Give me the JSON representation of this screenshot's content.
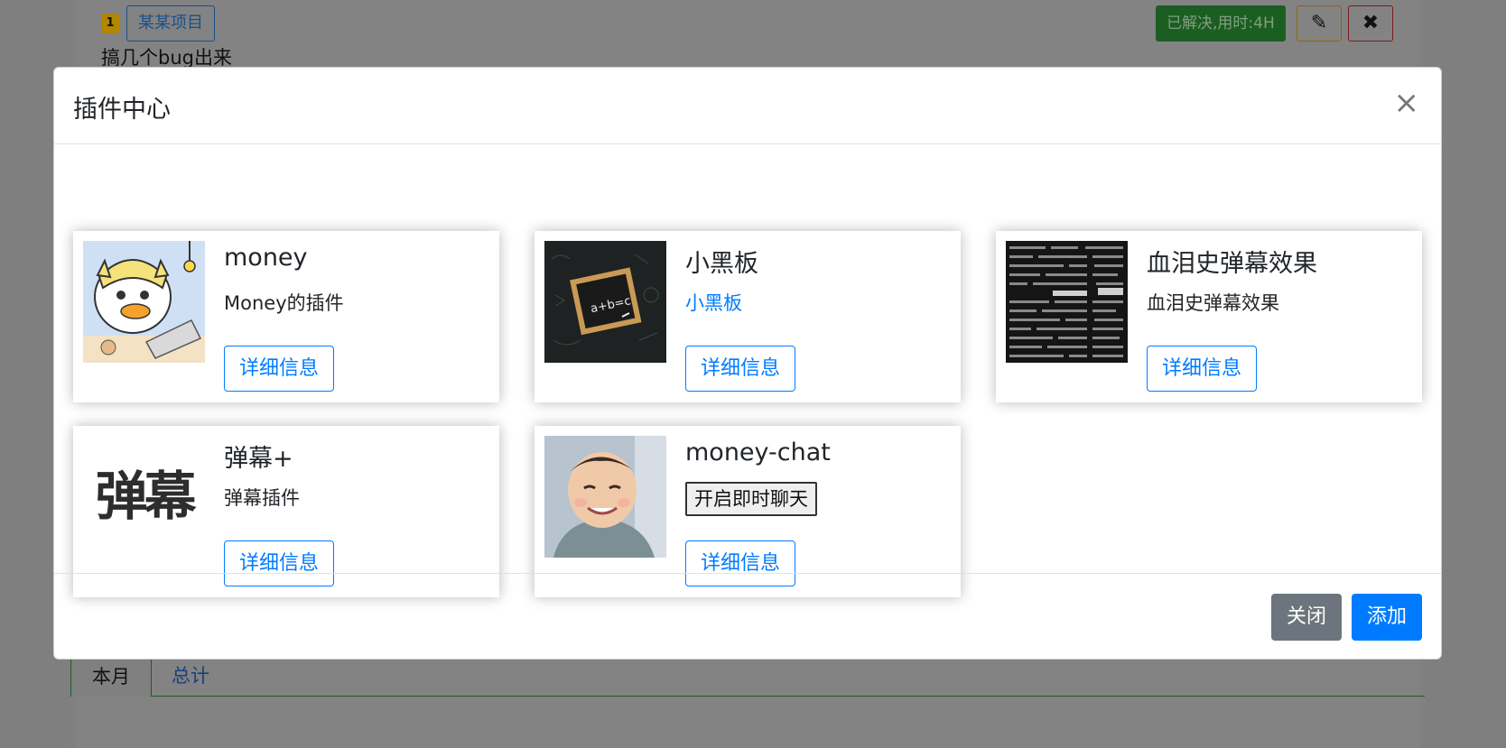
{
  "background": {
    "issue_number": "1",
    "project_tag": "某某项目",
    "issue_title": "搞几个bug出来",
    "status_badge": "已解决,用时:4H",
    "edit_icon": "pencil-icon",
    "delete_icon": "close-x-icon",
    "tabs": [
      "本月",
      "总计"
    ]
  },
  "modal": {
    "title": "插件中心",
    "close_symbol": "×",
    "plugins": [
      {
        "name": "money",
        "description": "Money的插件",
        "detail_label": "详细信息",
        "image": "cartoon-duck-laptop"
      },
      {
        "name": "小黑板",
        "description": "小黑板",
        "detail_label": "详细信息",
        "image": "chalkboard"
      },
      {
        "name": "血泪史弹幕效果",
        "description": "血泪史弹幕效果",
        "detail_label": "详细信息",
        "image": "danmaku-text-wall"
      },
      {
        "name": "弹幕+",
        "description": "弹幕插件",
        "detail_label": "详细信息",
        "image": "danmaku-logo",
        "image_text": "弹幕"
      },
      {
        "name": "money-chat",
        "action_label": "开启即时聊天",
        "detail_label": "详细信息",
        "image": "smiling-baby"
      }
    ],
    "footer": {
      "close_label": "关闭",
      "add_label": "添加"
    }
  }
}
